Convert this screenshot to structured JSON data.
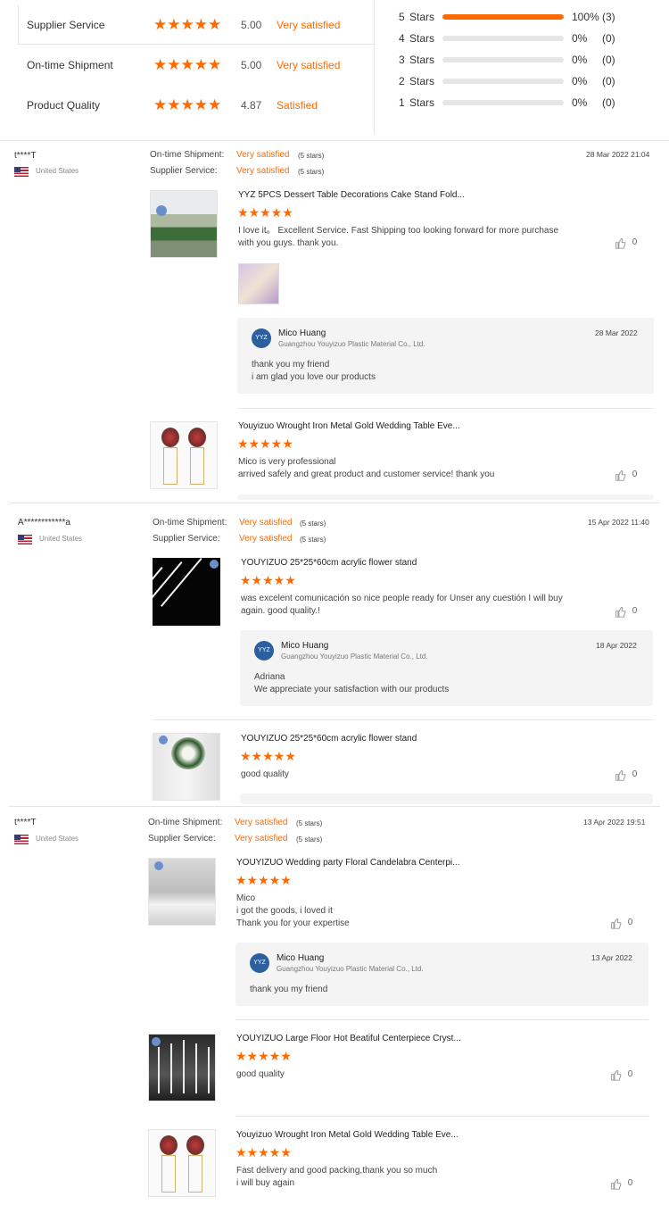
{
  "summary": {
    "ratings": [
      {
        "label": "Supplier Service",
        "stars": "★★★★★",
        "score": "5.00",
        "satisfaction": "Very satisfied"
      },
      {
        "label": "On-time Shipment",
        "stars": "★★★★★",
        "score": "5.00",
        "satisfaction": "Very satisfied"
      },
      {
        "label": "Product Quality",
        "stars": "★★★★★",
        "score": "4.87",
        "satisfaction": "Satisfied"
      }
    ],
    "distribution": [
      {
        "num": "5",
        "label": "Stars",
        "fraction": 1.0,
        "percent": "100%",
        "count": "(3)"
      },
      {
        "num": "4",
        "label": "Stars",
        "fraction": 0,
        "percent": "0%",
        "count": "(0)"
      },
      {
        "num": "3",
        "label": "Stars",
        "fraction": 0,
        "percent": "0%",
        "count": "(0)"
      },
      {
        "num": "2",
        "label": "Stars",
        "fraction": 0,
        "percent": "0%",
        "count": "(0)"
      },
      {
        "num": "1",
        "label": "Stars",
        "fraction": 0,
        "percent": "0%",
        "count": "(0)"
      }
    ]
  },
  "labels": {
    "ontime": "On-time Shipment:",
    "supplier": "Supplier Service:",
    "very_satisfied": "Very satisfied",
    "five_stars": "(5 stars)",
    "stars": "★★★★★",
    "like_count": "0",
    "icon_thumbs": "thumbs-up-icon"
  },
  "reviews": [
    {
      "name": "t****T",
      "country": "United States",
      "date": "28 Mar 2022 21:04",
      "items": [
        {
          "title": "YYZ 5PCS Dessert Table Decorations Cake Stand Fold...",
          "text": "I love it。 Excellent Service. Fast Shipping too looking forward for more purchase\nwith you guys. thank you.",
          "reply": {
            "name": "Mico Huang",
            "company": "Guangzhou Youyizuo Plastic Material Co., Ltd.",
            "date": "28 Mar 2022",
            "text": "thank you my friend\ni am glad you love our products"
          }
        },
        {
          "title": "Youyizuo Wrought Iron Metal Gold Wedding Table Eve...",
          "text": "Mico is very professional\narrived safely and great product and customer service! thank you"
        }
      ]
    },
    {
      "name": "A************a",
      "country": "United States",
      "date": "15 Apr 2022 11:40",
      "items": [
        {
          "title": "YOUYIZUO 25*25*60cm acrylic flower stand",
          "text": "was excelent comunicación so nice people ready for Unser any cuestión I will buy\nagain. good  quality.!",
          "reply": {
            "name": "Mico Huang",
            "company": "Guangzhou Youyizuo Plastic Material Co., Ltd.",
            "date": "18 Apr 2022",
            "text": "Adriana\nWe appreciate your satisfaction with our products"
          }
        },
        {
          "title": "YOUYIZUO 25*25*60cm acrylic flower stand",
          "text": "good quality"
        }
      ]
    },
    {
      "name": "t****T",
      "country": "United States",
      "date": "13 Apr 2022 19:51",
      "items": [
        {
          "title": "YOUYIZUO Wedding party Floral Candelabra Centerpi...",
          "text": "Mico\ni got the goods, i loved it\nThank you for your expertise",
          "reply": {
            "name": "Mico Huang",
            "company": "Guangzhou Youyizuo Plastic Material Co., Ltd.",
            "date": "13 Apr 2022",
            "text": "thank you my friend"
          }
        },
        {
          "title": "YOUYIZUO Large Floor Hot Beatiful Centerpiece Cryst...",
          "text": "good quality"
        },
        {
          "title": "Youyizuo Wrought Iron Metal Gold Wedding Table Eve...",
          "text": "Fast delivery and good packing,thank you so much\ni will buy again"
        }
      ]
    }
  ]
}
